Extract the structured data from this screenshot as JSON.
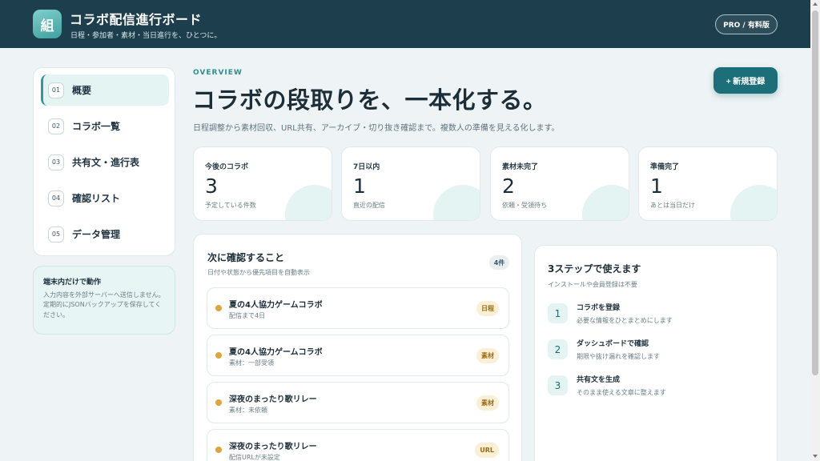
{
  "header": {
    "logo_char": "組",
    "title": "コラボ配信進行ボード",
    "subtitle": "日程・参加者・素材・当日進行を、ひとつに。",
    "plan_badge": "PRO / 有料版"
  },
  "sidebar": {
    "items": [
      {
        "num": "01",
        "label": "概要",
        "active": true
      },
      {
        "num": "02",
        "label": "コラボ一覧",
        "active": false
      },
      {
        "num": "03",
        "label": "共有文・進行表",
        "active": false
      },
      {
        "num": "04",
        "label": "確認リスト",
        "active": false
      },
      {
        "num": "05",
        "label": "データ管理",
        "active": false
      }
    ],
    "note": {
      "title": "端末内だけで動作",
      "text": "入力内容を外部サーバーへ送信しません。定期的にJSONバックアップを保存してください。"
    }
  },
  "hero": {
    "eyebrow": "OVERVIEW",
    "title": "コラボの段取りを、一本化する。",
    "description": "日程調整から素材回収、URL共有、アーカイブ・切り抜き確認まで。複数人の準備を見える化します。",
    "new_button": "+ 新規登録"
  },
  "stats": [
    {
      "label": "今後のコラボ",
      "value": "3",
      "caption": "予定している件数"
    },
    {
      "label": "7日以内",
      "value": "1",
      "caption": "直近の配信"
    },
    {
      "label": "素材未完了",
      "value": "2",
      "caption": "依頼・受領待ち"
    },
    {
      "label": "準備完了",
      "value": "1",
      "caption": "あとは当日だけ"
    }
  ],
  "checklist": {
    "title": "次に確認すること",
    "subtitle": "日付や状態から優先項目を自動表示",
    "count": "4件",
    "items": [
      {
        "title": "夏の4人協力ゲームコラボ",
        "meta": "配信まで4日",
        "tag": "日程"
      },
      {
        "title": "夏の4人協力ゲームコラボ",
        "meta": "素材：一部受領",
        "tag": "素材"
      },
      {
        "title": "深夜のまったり歌リレー",
        "meta": "素材：未依頼",
        "tag": "素材"
      },
      {
        "title": "深夜のまったり歌リレー",
        "meta": "配信URLが未設定",
        "tag": "URL"
      }
    ]
  },
  "steps": {
    "title": "3ステップで使えます",
    "subtitle": "インストールや会員登録は不要",
    "items": [
      {
        "num": "1",
        "title": "コラボを登録",
        "desc": "必要な情報をひとまとめにします"
      },
      {
        "num": "2",
        "title": "ダッシュボードで確認",
        "desc": "期限や抜け漏れを確認します"
      },
      {
        "num": "3",
        "title": "共有文を生成",
        "desc": "そのまま使える文章に整えます"
      }
    ]
  },
  "colors": {
    "header_bg": "#1d3e4c",
    "accent": "#2f9a98",
    "button_bg": "#1c6f78",
    "tag_bg": "#fbf0d6",
    "dot": "#e0a43a"
  }
}
